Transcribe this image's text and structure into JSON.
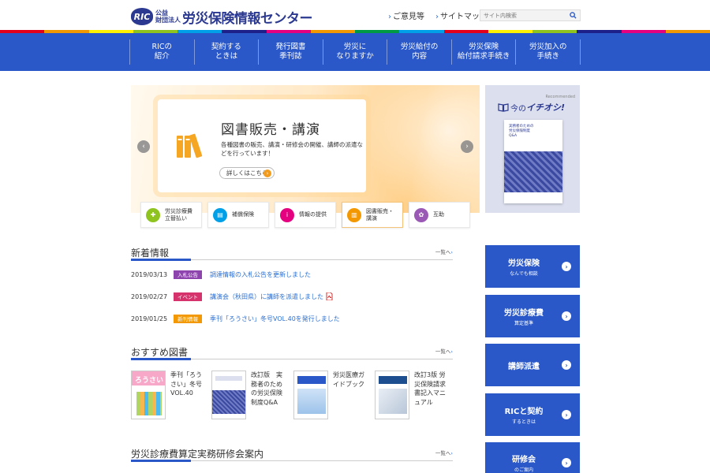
{
  "header": {
    "logo_mark": "RIC",
    "logo_sub1": "公益",
    "logo_sub2": "財団法人",
    "logo_main": "労災保険情報センター",
    "links": [
      "ご意見等",
      "サイトマップ"
    ],
    "search_placeholder": "サイト内検索"
  },
  "stripe_colors": [
    "#e2001a",
    "#f39800",
    "#fff100",
    "#8fc31f",
    "#00a0e9",
    "#1d2088",
    "#e4007f",
    "#f39800",
    "#009944",
    "#00a0e9",
    "#e2001a",
    "#fff100",
    "#8fc31f",
    "#1d2088",
    "#e4007f",
    "#f39800"
  ],
  "nav": {
    "items": [
      "RICの\n紹介",
      "契約する\nときは",
      "発行図書\n季刊誌",
      "労災に\nなりますか",
      "労災給付の\n内容",
      "労災保険\n給付請求手続き",
      "労災加入の\n手続き"
    ]
  },
  "hero": {
    "title": "図書販売・講演",
    "desc": "各種図書の販売、講演・研修会の開催、講師の派遣などを行っています！",
    "more_label": "詳しくはこちら",
    "tabs": [
      {
        "label": "労災診療費\n立替払い",
        "color": "#8fc31f"
      },
      {
        "label": "補償保険",
        "color": "#00a0e9"
      },
      {
        "label": "情報の提供",
        "color": "#e4007f"
      },
      {
        "label": "図書販売・\n講演",
        "color": "#f39800"
      },
      {
        "label": "互助",
        "color": "#9b59b6"
      }
    ]
  },
  "recommend": {
    "label": "Recommended",
    "title_prefix": "今の",
    "title_main": "イチオシ!",
    "book_head": "実務者のための\n労災保険制度\nQ&A"
  },
  "news": {
    "title": "新着情報",
    "more": "一覧へ",
    "items": [
      {
        "date": "2019/03/13",
        "badge": "入札公告",
        "badge_color": "#8e44ad",
        "title": "調達情報の入札公告を更新しました",
        "pdf": false
      },
      {
        "date": "2019/02/27",
        "badge": "イベント",
        "badge_color": "#d6336c",
        "title": "講演会（秋田県）に講師を派遣しました",
        "pdf": true
      },
      {
        "date": "2019/01/25",
        "badge": "新刊情報",
        "badge_color": "#f39800",
        "title": "季刊「ろうさい」冬号VOL.40を発行しました",
        "pdf": false
      }
    ]
  },
  "books": {
    "title": "おすすめ図書",
    "more": "一覧へ",
    "items": [
      {
        "name": "季刊「ろうさい」冬号VOL.40"
      },
      {
        "name": "改訂版　実務者のための労災保険制度Q&A"
      },
      {
        "name": "労災医療ガイドブック"
      },
      {
        "name": "改訂3版 労災保険請求書記入マニュアル"
      }
    ]
  },
  "seminar": {
    "title": "労災診療費算定実務研修会案内",
    "more": "一覧へ"
  },
  "side_buttons": [
    {
      "t1": "労災保険",
      "t2": "なんでも相談"
    },
    {
      "t1": "労災診療費",
      "t2": "算定基準"
    },
    {
      "t1": "講師派遣",
      "t2": ""
    },
    {
      "t1": "RICと契約",
      "t2": "するときは"
    },
    {
      "t1": "研修会",
      "t2": "のご案内"
    }
  ]
}
